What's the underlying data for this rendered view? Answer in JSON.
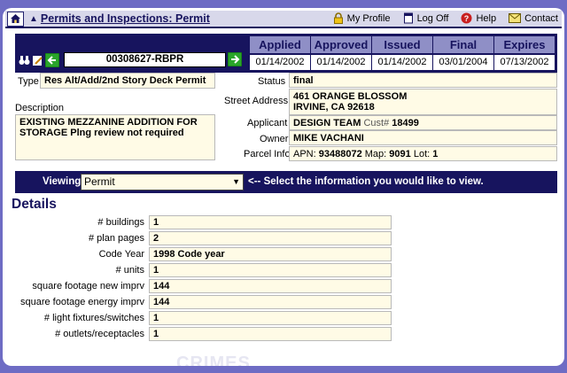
{
  "nav": {
    "title": "Permits and Inspections: Permit",
    "links": [
      {
        "label": "My Profile",
        "icon": "lock-icon"
      },
      {
        "label": "Log Off",
        "icon": "document-icon"
      },
      {
        "label": "Help",
        "icon": "help-icon"
      },
      {
        "label": "Contact",
        "icon": "envelope-icon"
      }
    ]
  },
  "permit": {
    "number": "00308627-RBPR",
    "dates": [
      {
        "label": "Applied",
        "value": "01/14/2002"
      },
      {
        "label": "Approved",
        "value": "01/14/2002"
      },
      {
        "label": "Issued",
        "value": "01/14/2002"
      },
      {
        "label": "Final",
        "value": "03/01/2004"
      },
      {
        "label": "Expires",
        "value": "07/13/2002"
      }
    ]
  },
  "info": {
    "type_label": "Type",
    "type_value": "Res Alt/Add/2nd Story Deck Permit",
    "description_label": "Description",
    "description_value": "EXISTING MEZZANINE ADDITION FOR STORAGE Plng review not required",
    "status_label": "Status",
    "status_value": "final",
    "address_label": "Street Address",
    "address_line1": "461 ORANGE BLOSSOM",
    "address_line2": "IRVINE, CA 92618",
    "applicant_label": "Applicant",
    "applicant_name": "DESIGN TEAM",
    "applicant_cust_label": "Cust#",
    "applicant_cust": "18499",
    "owner_label": "Owner",
    "owner_value": "MIKE VACHANI",
    "parcel_label": "Parcel Info",
    "apn_label": "APN:",
    "apn_value": "93488072",
    "map_label": "Map:",
    "map_value": "9091",
    "lot_label": "Lot:",
    "lot_value": "1"
  },
  "viewing": {
    "label": "Viewing",
    "selected": "Permit",
    "hint": "<-- Select the information you would like to view."
  },
  "details": {
    "heading": "Details",
    "rows": [
      {
        "label": "# buildings",
        "value": "1"
      },
      {
        "label": "# plan pages",
        "value": "2"
      },
      {
        "label": "Code Year",
        "value": "1998 Code year"
      },
      {
        "label": "# units",
        "value": "1"
      },
      {
        "label": "square footage new imprv",
        "value": "144"
      },
      {
        "label": "square footage energy imprv",
        "value": "144"
      },
      {
        "label": "# light fixtures/switches",
        "value": "1"
      },
      {
        "label": "# outlets/receptacles",
        "value": "1"
      }
    ]
  },
  "watermark": "CRIMES",
  "colors": {
    "navy": "#17145e",
    "header_cell": "#8f8fc6",
    "field_bg": "#fffbe6",
    "page_bg": "#6e6cc4"
  }
}
